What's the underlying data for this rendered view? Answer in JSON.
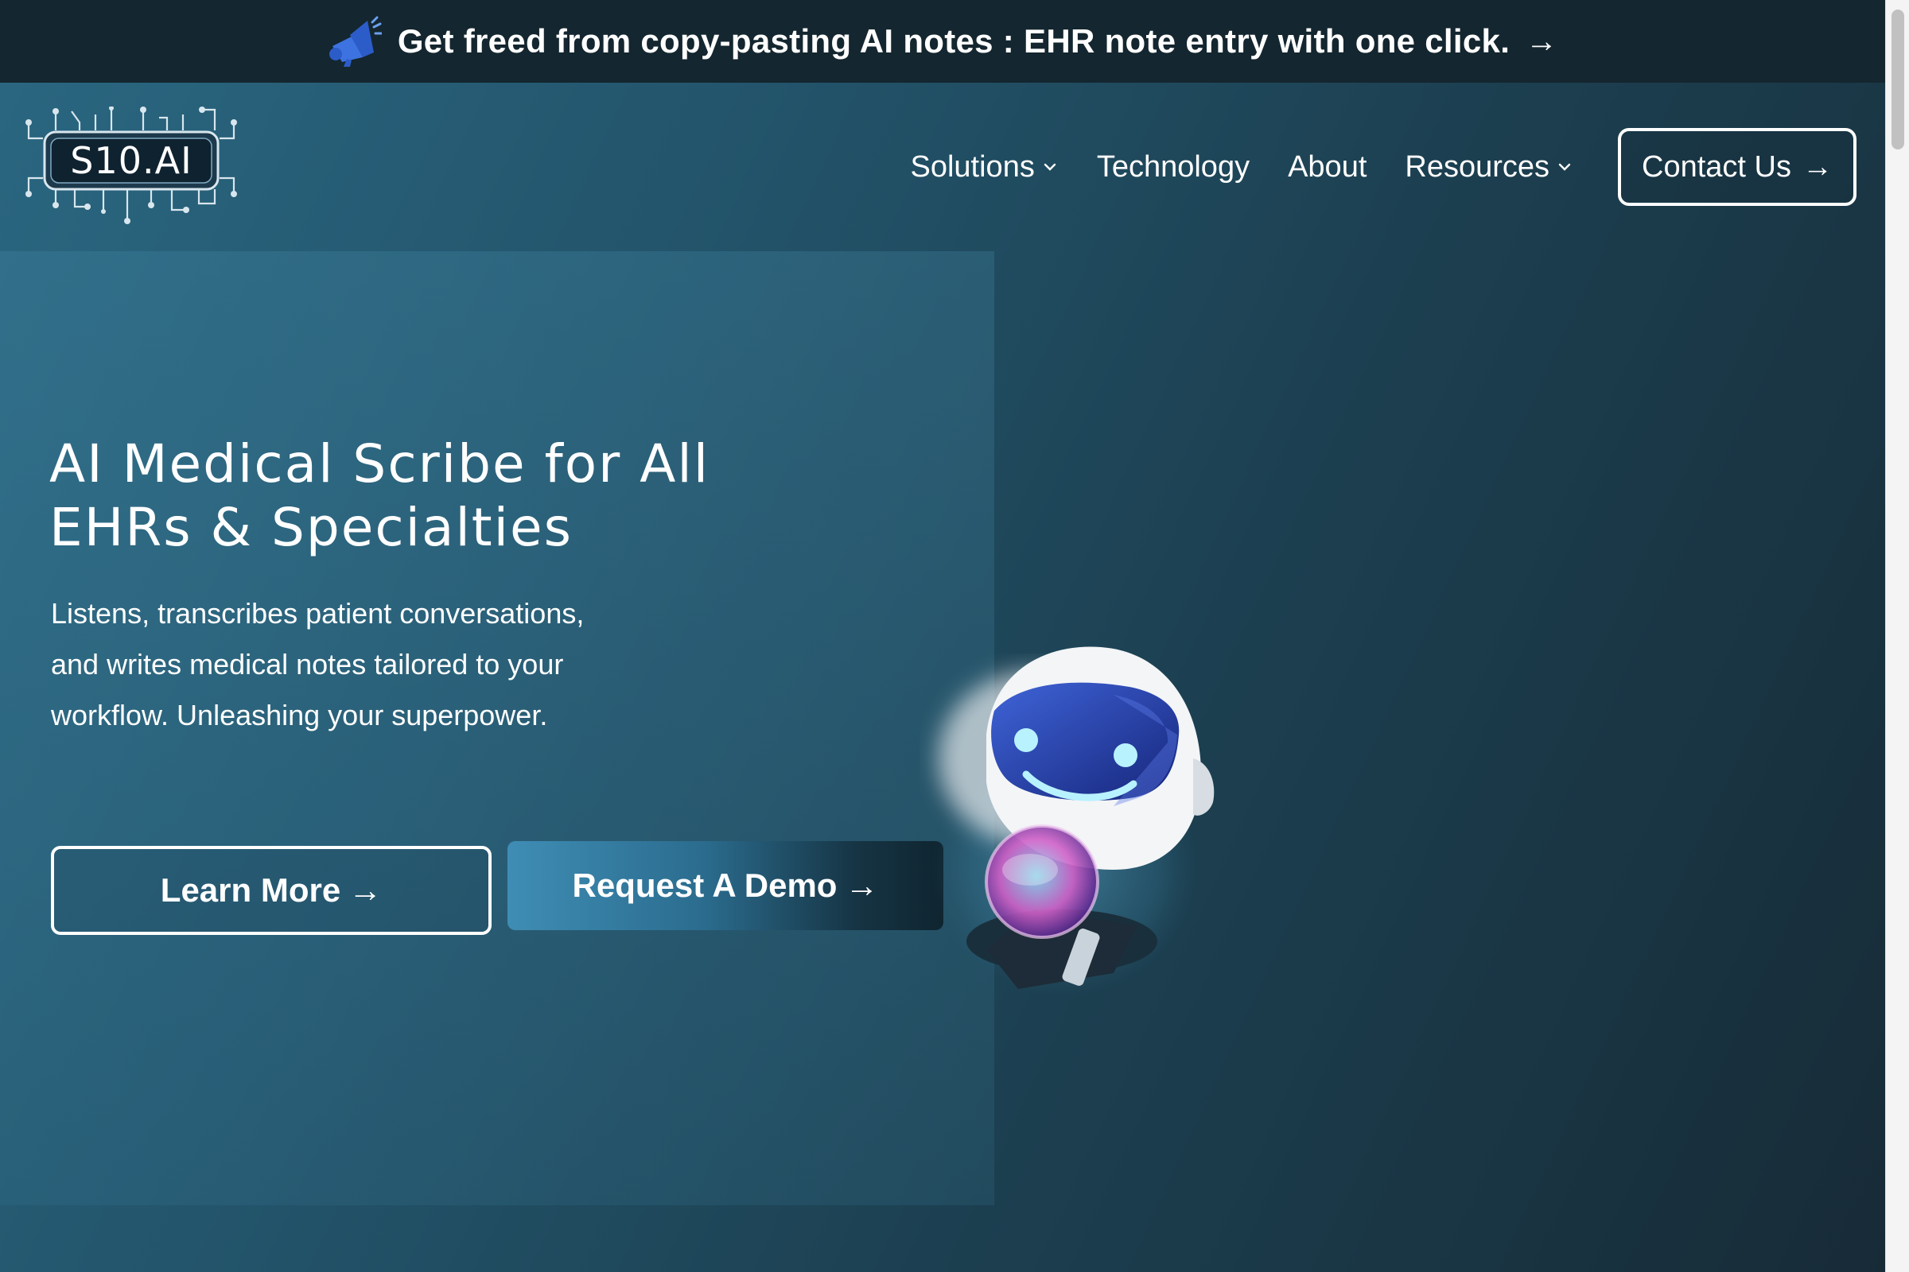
{
  "announcement": {
    "text": "Get freed from copy-pasting AI notes : EHR note entry with one click.",
    "arrow": "→",
    "icon": "megaphone-icon"
  },
  "logo": {
    "text": "S10.AI"
  },
  "nav": {
    "items": [
      {
        "label": "Solutions",
        "has_dropdown": true
      },
      {
        "label": "Technology",
        "has_dropdown": false
      },
      {
        "label": "About",
        "has_dropdown": false
      },
      {
        "label": "Resources",
        "has_dropdown": true
      }
    ],
    "contact_label": "Contact Us",
    "contact_arrow": "→"
  },
  "hero": {
    "title_line1": "AI Medical Scribe for All",
    "title_line2": "EHRs & Specialties",
    "subtitle_line1": "Listens, transcribes patient conversations,",
    "subtitle_line2": "and writes medical notes tailored to your",
    "subtitle_line3": "workflow. Unleashing your superpower.",
    "learn_more_label": "Learn More",
    "request_demo_label": "Request A Demo",
    "arrow": "→"
  },
  "colors": {
    "announcement_bg": "#14262f",
    "page_gradient_start": "#2a6680",
    "page_gradient_end": "#172b37",
    "accent_blue": "#3f8db5",
    "text": "#ffffff"
  }
}
